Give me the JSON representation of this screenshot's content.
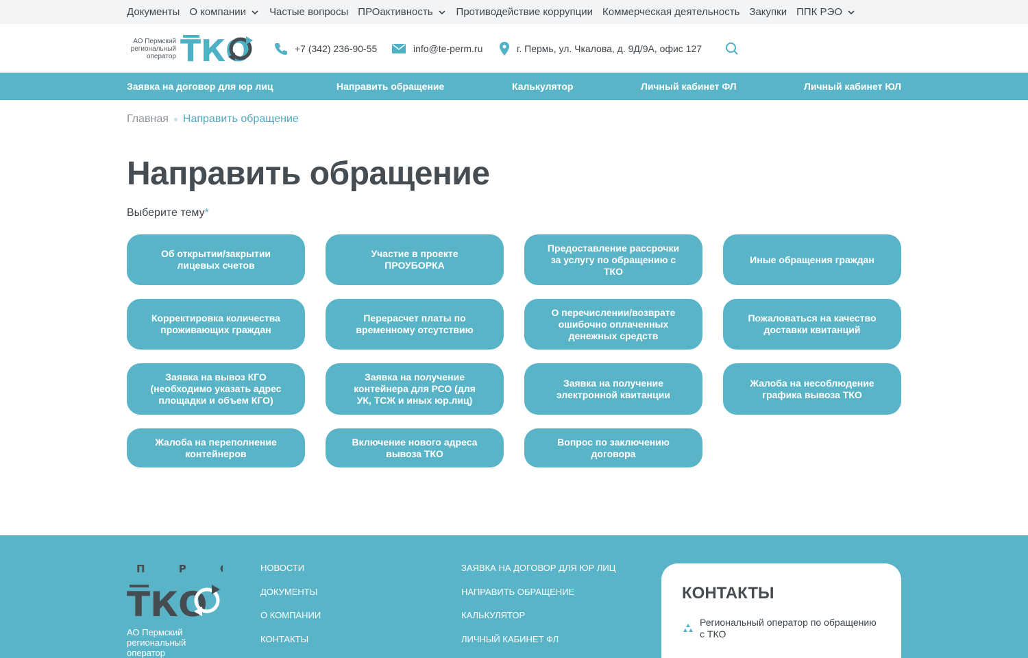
{
  "topnav": {
    "items": [
      {
        "label": "Документы",
        "dropdown": false
      },
      {
        "label": "О компании",
        "dropdown": true
      },
      {
        "label": "Частые вопросы",
        "dropdown": false
      },
      {
        "label": "ПРОактивность",
        "dropdown": true
      },
      {
        "label": "Противодействие коррупции",
        "dropdown": false
      },
      {
        "label": "Коммерческая деятельность",
        "dropdown": false
      },
      {
        "label": "Закупки",
        "dropdown": false
      },
      {
        "label": "ППК РЭО",
        "dropdown": true
      }
    ]
  },
  "header": {
    "logo_caption": "АО Пермский региональный оператор",
    "logo_mark": "ТКО",
    "phone": "+7 (342) 236-90-55",
    "email": "info@te-perm.ru",
    "address": "г. Пермь, ул. Чкалова, д. 9Д/9А, офис 127"
  },
  "mainmenu": {
    "items": [
      "Заявка на договор для юр лиц",
      "Направить обращение",
      "Калькулятор",
      "Личный кабинет ФЛ",
      "Личный кабинет ЮЛ"
    ]
  },
  "breadcrumb": {
    "home": "Главная",
    "current": "Направить обращение"
  },
  "page": {
    "title": "Направить обращение",
    "subject_label": "Выберите тему",
    "required_mark": "*"
  },
  "topics": [
    "Об открытии/закрытии лицевых счетов",
    "Участие в проекте ПРОУБОРКА",
    "Предоставление рассрочки за услугу по обращению с ТКО",
    "Иные обращения граждан",
    "Корректировка количества проживающих граждан",
    "Перерасчет платы по временному отсутствию",
    "О перечислении/возврате ошибочно оплаченных денежных средств",
    "Пожаловаться на качество доставки квитанций",
    "Заявка на вывоз КГО (необходимо указать адрес площадки и объем КГО)",
    "Заявка на получение контейнера для РСО (для УК, ТСЖ и иных юр.лиц)",
    "Заявка на получение электронной квитанции",
    "Жалоба на несоблюдение графика вывоза ТКО",
    "Жалоба на переполнение контейнеров",
    "Включение нового адреса вывоза ТКО",
    "Вопрос по заключению договора"
  ],
  "footer": {
    "logo_top": "П Р О",
    "logo_mark": "ТКО",
    "logo_caption": "АО Пермский региональный оператор",
    "col1": [
      "Новости",
      "Документы",
      "О компании",
      "Контакты"
    ],
    "col2": [
      "Заявка на договор для юр лиц",
      "Направить обращение",
      "Калькулятор",
      "Личный кабинет ФЛ"
    ],
    "contacts_title": "КОНТАКТЫ",
    "contacts_org": "Региональный оператор по обращению с ТКО"
  },
  "colors": {
    "accent": "#59b4c8",
    "dark": "#454c52"
  }
}
